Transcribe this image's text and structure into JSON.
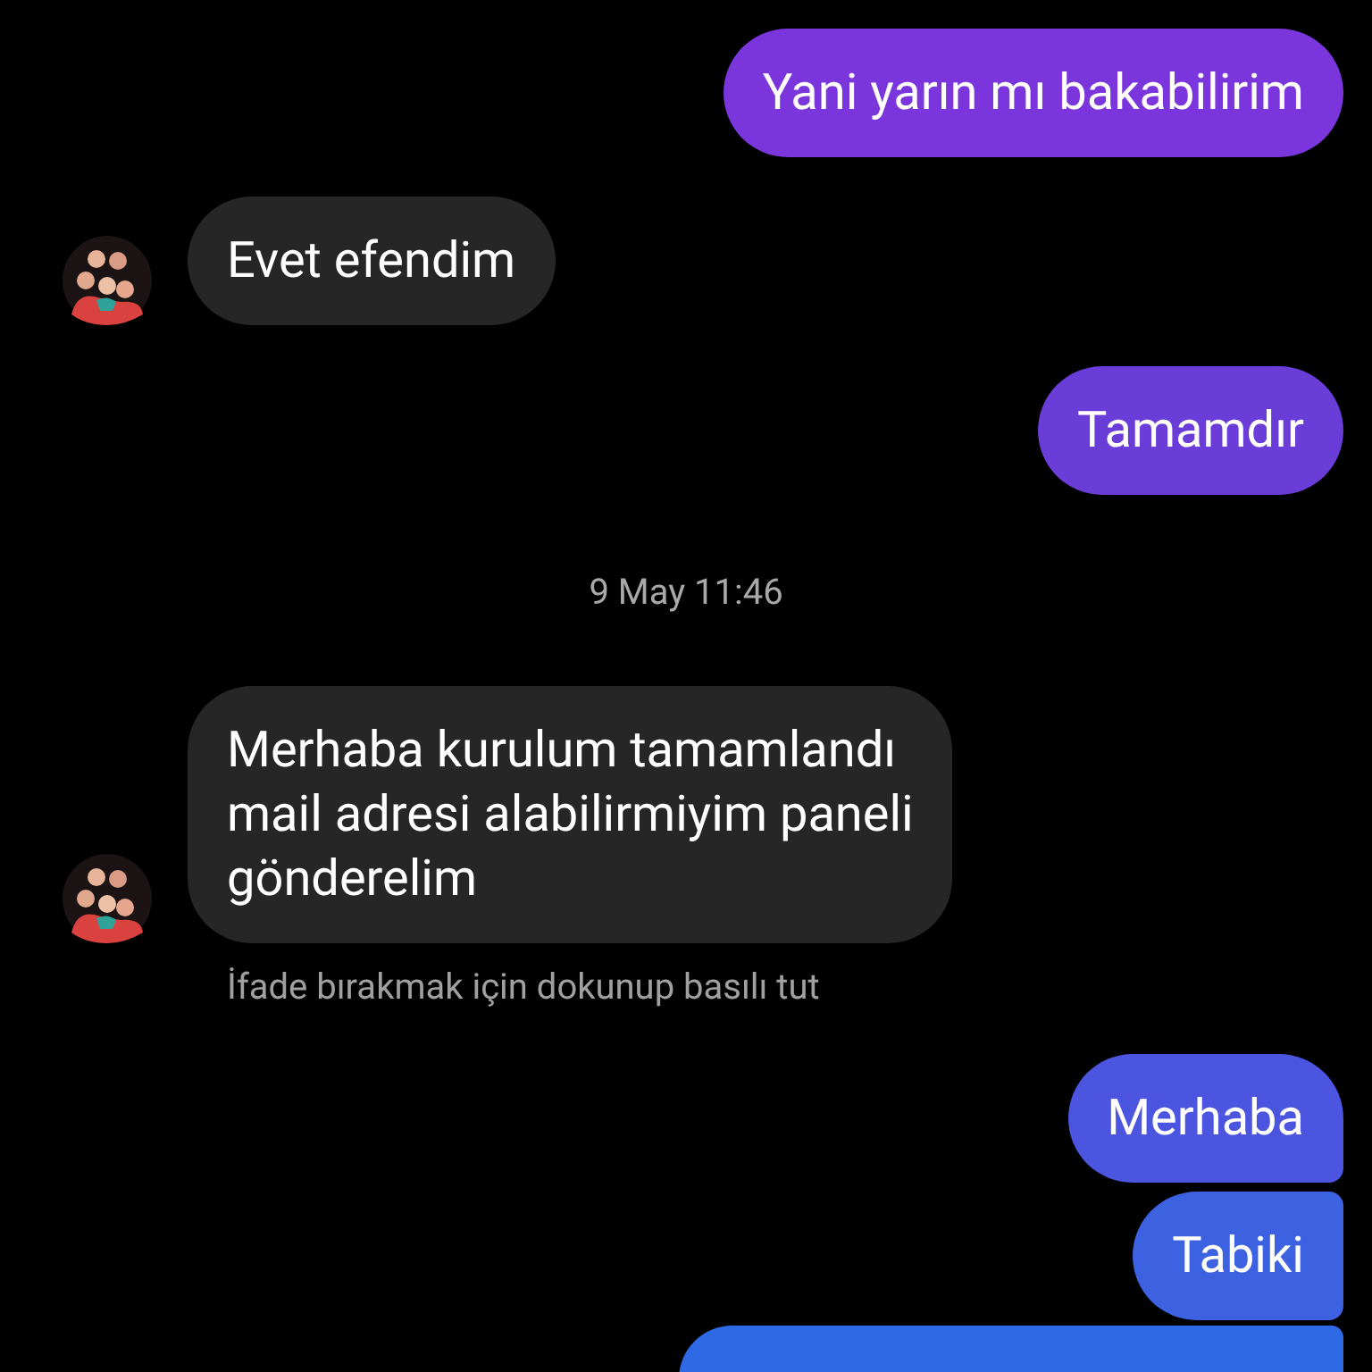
{
  "messages": [
    {
      "kind": "outgoing",
      "text": "Yani yarın mı bakabilirim"
    },
    {
      "kind": "incoming",
      "lines": [
        "Evet efendim"
      ]
    },
    {
      "kind": "outgoing",
      "text": "Tamamdır"
    },
    {
      "kind": "timestamp",
      "text": "9 May 11:46"
    },
    {
      "kind": "incoming",
      "lines": [
        "Merhaba kurulum tamamlandı",
        "mail adresi alabilirmiyim paneli",
        "gönderelim"
      ]
    },
    {
      "kind": "hint",
      "text": "İfade bırakmak için dokunup basılı tut"
    },
    {
      "kind": "outgoing",
      "text": "Merhaba"
    },
    {
      "kind": "outgoing",
      "text": "Tabiki"
    },
    {
      "kind": "partial"
    }
  ]
}
